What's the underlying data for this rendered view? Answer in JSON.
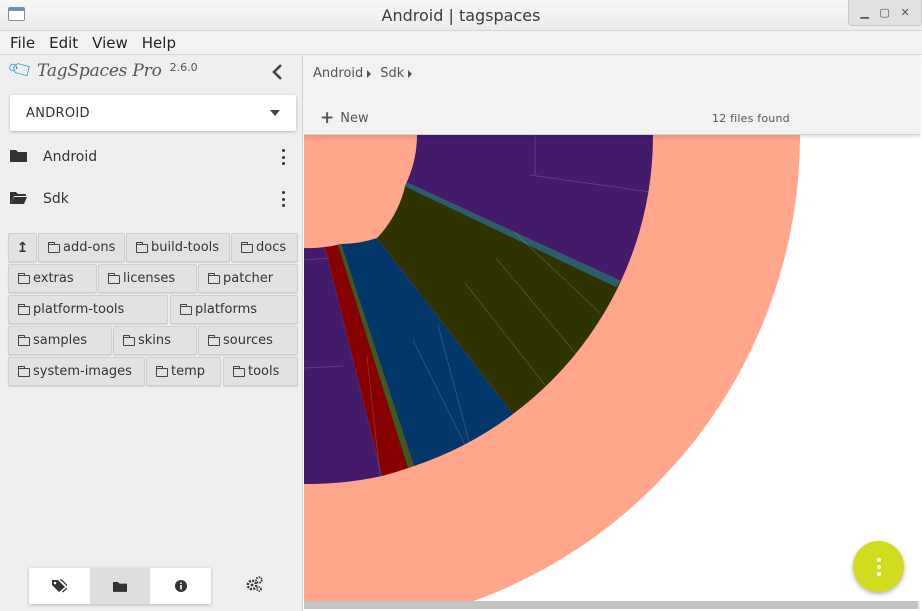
{
  "window": {
    "title": "Android | tagspaces"
  },
  "menu": [
    "File",
    "Edit",
    "View",
    "Help"
  ],
  "sidebar": {
    "brand": "TagSpaces Pro",
    "version": "2.6.0",
    "location": "ANDROID",
    "directories": [
      {
        "label": "Android",
        "open": false
      },
      {
        "label": "Sdk",
        "open": true
      }
    ],
    "subfolders": [
      "add-ons",
      "build-tools",
      "docs",
      "extras",
      "licenses",
      "patcher",
      "platform-tools",
      "platforms",
      "samples",
      "skins",
      "sources",
      "system-images",
      "temp",
      "tools"
    ],
    "bottom_tabs": [
      {
        "icon": "tags-icon",
        "active": false
      },
      {
        "icon": "folder-icon",
        "active": true
      },
      {
        "icon": "info-icon",
        "active": false
      }
    ]
  },
  "topbar": {
    "breadcrumb": [
      "Android",
      "Sdk"
    ],
    "new_label": "New",
    "files_found": "12 files found"
  },
  "colors": {
    "accent": "#d2dc1f",
    "sunburst_outer": "#ffa68b",
    "purple": "#441a6b",
    "olive": "#2f3300",
    "blue": "#033669",
    "red": "#870000"
  }
}
